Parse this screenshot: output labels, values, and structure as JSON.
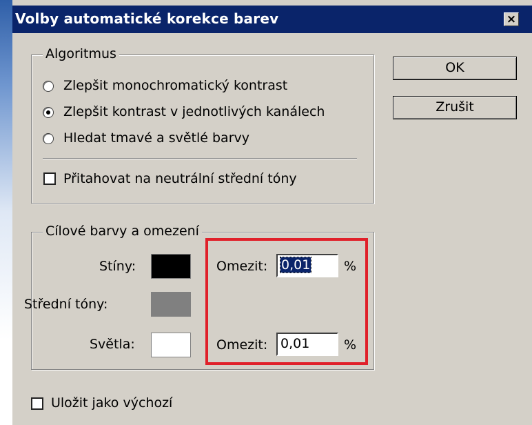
{
  "window": {
    "title": "Volby automatické korekce barev",
    "close_glyph": "×"
  },
  "algorithm": {
    "legend": "Algoritmus",
    "options": [
      {
        "label": "Zlepšit monochromatický kontrast",
        "selected": false
      },
      {
        "label": "Zlepšit kontrast v jednotlivých kanálech",
        "selected": true
      },
      {
        "label": "Hledat tmavé a světlé barvy",
        "selected": false
      }
    ],
    "snap_neutral": {
      "label": "Přitahovat na neutrální střední tóny",
      "checked": false
    }
  },
  "targets": {
    "legend": "Cílové barvy a omezení",
    "shadows": {
      "label": "Stíny:",
      "color": "#000000",
      "clip_label": "Omezit:",
      "clip_value": "0,01",
      "unit": "%"
    },
    "midtones": {
      "label": "Střední tóny:",
      "color": "#808080"
    },
    "highlights": {
      "label": "Světla:",
      "color": "#ffffff",
      "clip_label": "Omezit:",
      "clip_value": "0,01",
      "unit": "%"
    },
    "highlight_color": "#e0202a"
  },
  "buttons": {
    "ok": "OK",
    "cancel": "Zrušit"
  },
  "save_default": {
    "label": "Uložit jako výchozí",
    "checked": false
  }
}
